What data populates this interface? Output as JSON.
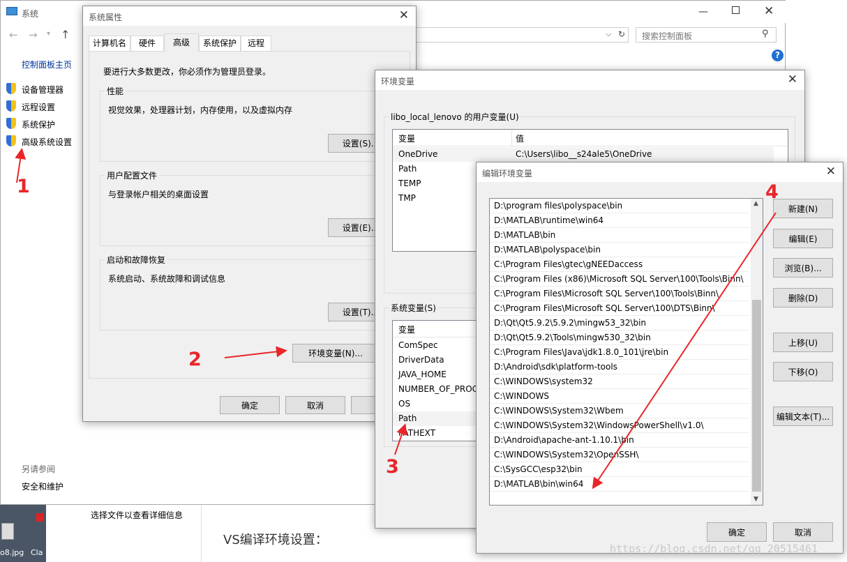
{
  "system_window": {
    "title": "系统",
    "search_placeholder": "搜索控制面板",
    "sidebar": {
      "home": "控制面板主页",
      "items": [
        {
          "label": "设备管理器"
        },
        {
          "label": "远程设置"
        },
        {
          "label": "系统保护"
        },
        {
          "label": "高级系统设置"
        }
      ],
      "see_also": "另请参阅",
      "security": "安全和维护"
    },
    "details_hint": "选择文件以查看详细信息",
    "vs_text": "VS编译环境设置：",
    "taskbar": {
      "file1": "o8.jpg",
      "file2": "Cla"
    }
  },
  "sys_props": {
    "title": "系统属性",
    "tabs": [
      "计算机名",
      "硬件",
      "高级",
      "系统保护",
      "远程"
    ],
    "active_tab": "高级",
    "admin_note": "要进行大多数更改，你必须作为管理员登录。",
    "perf_title": "性能",
    "perf_desc": "视觉效果，处理器计划，内存使用，以及虚拟内存",
    "settings_s": "设置(S)...",
    "profile_title": "用户配置文件",
    "profile_desc": "与登录帐户相关的桌面设置",
    "settings_e": "设置(E)...",
    "startup_title": "启动和故障恢复",
    "startup_desc": "系统启动、系统故障和调试信息",
    "settings_t": "设置(T)...",
    "env_btn": "环境变量(N)...",
    "ok": "确定",
    "cancel": "取消",
    "apply": "应"
  },
  "env_vars": {
    "title": "环境变量",
    "user_group": "libo_local_lenovo 的用户变量(U)",
    "col_var": "变量",
    "col_val": "值",
    "user_rows": [
      {
        "var": "OneDrive",
        "val": "C:\\Users\\libo__s24ale5\\OneDrive"
      },
      {
        "var": "Path"
      },
      {
        "var": "TEMP"
      },
      {
        "var": "TMP"
      }
    ],
    "sys_group": "系统变量(S)",
    "sys_rows": [
      {
        "var": "ComSpec"
      },
      {
        "var": "DriverData"
      },
      {
        "var": "JAVA_HOME"
      },
      {
        "var": "NUMBER_OF_PROC"
      },
      {
        "var": "OS"
      },
      {
        "var": "Path"
      },
      {
        "var": "PATHEXT"
      }
    ]
  },
  "edit_env": {
    "title": "编辑环境变量",
    "paths": [
      "D:\\program files\\polyspace\\bin",
      "D:\\MATLAB\\runtime\\win64",
      "D:\\MATLAB\\bin",
      "D:\\MATLAB\\polyspace\\bin",
      "C:\\Program Files\\gtec\\gNEEDaccess",
      "C:\\Program Files (x86)\\Microsoft SQL Server\\100\\Tools\\Binn\\",
      "C:\\Program Files\\Microsoft SQL Server\\100\\Tools\\Binn\\",
      "C:\\Program Files\\Microsoft SQL Server\\100\\DTS\\Binn\\",
      "D:\\Qt\\Qt5.9.2\\5.9.2\\mingw53_32\\bin",
      "D:\\Qt\\Qt5.9.2\\Tools\\mingw530_32\\bin",
      "C:\\Program Files\\Java\\jdk1.8.0_101\\jre\\bin",
      "D:\\Android\\sdk\\platform-tools",
      "C:\\WINDOWS\\system32",
      "C:\\WINDOWS",
      "C:\\WINDOWS\\System32\\Wbem",
      "C:\\WINDOWS\\System32\\WindowsPowerShell\\v1.0\\",
      "D:\\Android\\apache-ant-1.10.1\\bin",
      "C:\\WINDOWS\\System32\\OpenSSH\\",
      "C:\\SysGCC\\esp32\\bin",
      "D:\\MATLAB\\bin\\win64"
    ],
    "buttons": {
      "new": "新建(N)",
      "edit": "编辑(E)",
      "browse": "浏览(B)...",
      "delete": "删除(D)",
      "up": "上移(U)",
      "down": "下移(O)",
      "edit_text": "编辑文本(T)..."
    },
    "ok": "确定",
    "cancel": "取消"
  },
  "annotations": {
    "n1": "1",
    "n2": "2",
    "n3": "3",
    "n4": "4",
    "accent": "#e8262a"
  },
  "watermark": "https://blog.csdn.net/qq_20515461"
}
